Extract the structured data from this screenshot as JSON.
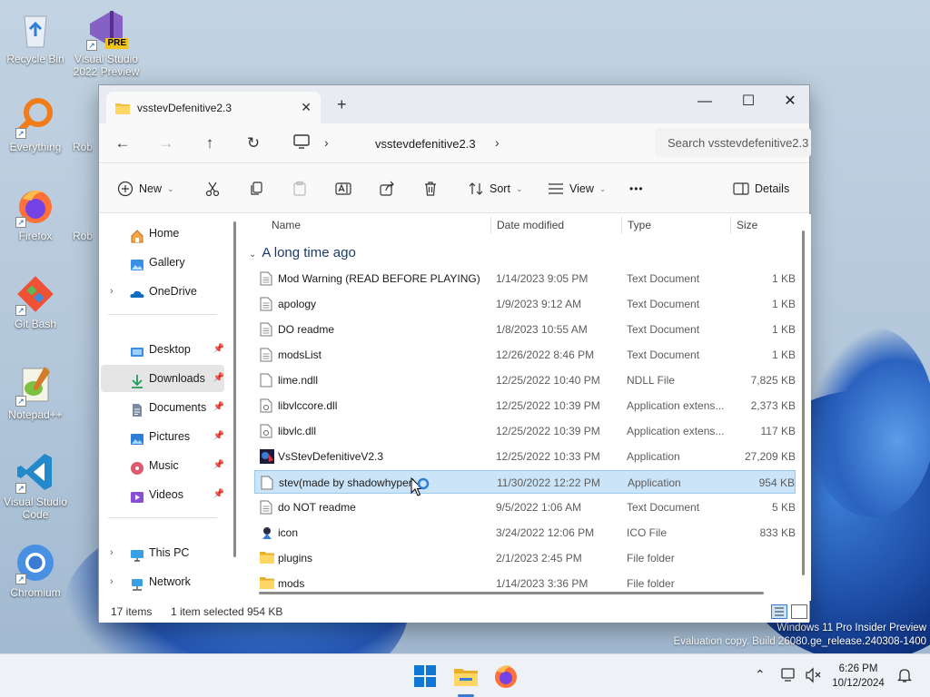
{
  "desktop": {
    "icons": [
      {
        "label": "Recycle Bin"
      },
      {
        "label": "Visual Studio 2022 Preview",
        "badge": "PRE"
      },
      {
        "label": "Everything"
      },
      {
        "label": "Roblo"
      },
      {
        "label": "Firefox"
      },
      {
        "label": "Roblo"
      },
      {
        "label": "Git Bash"
      },
      {
        "label": "Notepad++"
      },
      {
        "label": "Visual Studio Code"
      },
      {
        "label": "Chromium"
      }
    ],
    "watermark": {
      "line1": "Windows 11 Pro Insider Preview",
      "line2": "Evaluation copy. Build 26080.ge_release.240308-1400"
    }
  },
  "window": {
    "tab_title": "vsstevDefenitive2.3",
    "tab_close": "✕",
    "new_tab": "+",
    "controls": {
      "minimize": "—",
      "maximize": "☐",
      "close": "✕"
    },
    "address": {
      "crumb": "vsstevdefenitive2.3",
      "sep": "›"
    },
    "search_placeholder": "Search vsstevdefenitive2.3",
    "toolbar": {
      "new": "New",
      "sort": "Sort",
      "view": "View",
      "more": "•••",
      "details": "Details"
    },
    "sidebar": {
      "home": "Home",
      "gallery": "Gallery",
      "onedrive": "OneDrive",
      "desktop": "Desktop",
      "downloads": "Downloads",
      "documents": "Documents",
      "pictures": "Pictures",
      "music": "Music",
      "videos": "Videos",
      "thispc": "This PC",
      "network": "Network"
    },
    "columns": {
      "name": "Name",
      "date": "Date modified",
      "type": "Type",
      "size": "Size"
    },
    "group": "A long time ago",
    "files": [
      {
        "name": "Mod Warning (READ BEFORE PLAYING)",
        "date": "1/14/2023 9:05 PM",
        "type": "Text Document",
        "size": "1 KB"
      },
      {
        "name": "apology",
        "date": "1/9/2023 9:12 AM",
        "type": "Text Document",
        "size": "1 KB"
      },
      {
        "name": "DO readme",
        "date": "1/8/2023 10:55 AM",
        "type": "Text Document",
        "size": "1 KB"
      },
      {
        "name": "modsList",
        "date": "12/26/2022 8:46 PM",
        "type": "Text Document",
        "size": "1 KB"
      },
      {
        "name": "lime.ndll",
        "date": "12/25/2022 10:40 PM",
        "type": "NDLL File",
        "size": "7,825 KB"
      },
      {
        "name": "libvlccore.dll",
        "date": "12/25/2022 10:39 PM",
        "type": "Application extens...",
        "size": "2,373 KB"
      },
      {
        "name": "libvlc.dll",
        "date": "12/25/2022 10:39 PM",
        "type": "Application extens...",
        "size": "117 KB"
      },
      {
        "name": "VsStevDefenitiveV2.3",
        "date": "12/25/2022 10:33 PM",
        "type": "Application",
        "size": "27,209 KB"
      },
      {
        "name": "stev(made by shadowhyper)",
        "date": "11/30/2022 12:22 PM",
        "type": "Application",
        "size": "954 KB"
      },
      {
        "name": "do NOT readme",
        "date": "9/5/2022 1:06 AM",
        "type": "Text Document",
        "size": "5 KB"
      },
      {
        "name": "icon",
        "date": "3/24/2022 12:06 PM",
        "type": "ICO File",
        "size": "833 KB"
      },
      {
        "name": "plugins",
        "date": "2/1/2023 2:45 PM",
        "type": "File folder",
        "size": ""
      },
      {
        "name": "mods",
        "date": "1/14/2023 3:36 PM",
        "type": "File folder",
        "size": ""
      }
    ],
    "status": {
      "count": "17 items",
      "selection": "1 item selected",
      "selsize": "954 KB"
    }
  },
  "taskbar": {
    "time": "6:26 PM",
    "date": "10/12/2024"
  },
  "colors": {
    "accent": "#3a7bd5",
    "selection": "#cce4f7",
    "folder": "#f4c242"
  }
}
